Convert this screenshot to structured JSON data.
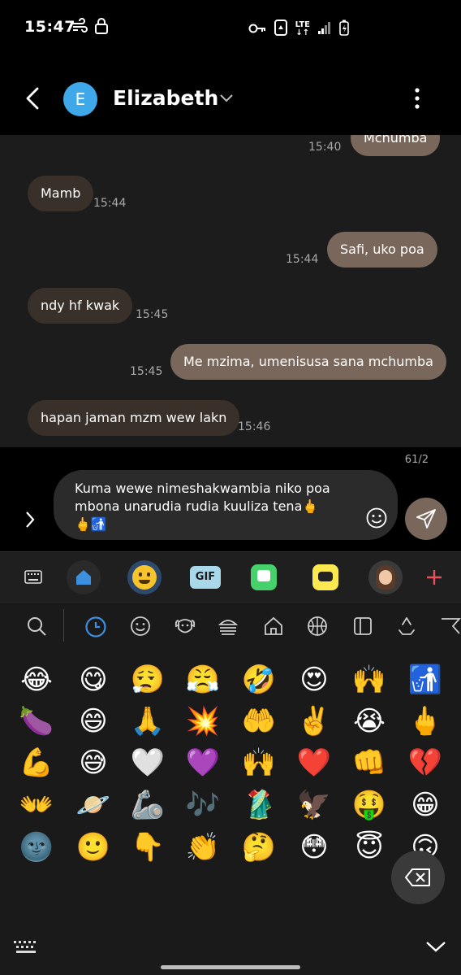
{
  "status_bar": {
    "time": "15:47",
    "network": "LTE"
  },
  "header": {
    "avatar_letter": "E",
    "contact_name": "Elizabeth",
    "avatar_color": "#3ea8e8"
  },
  "messages": [
    {
      "dir": "out",
      "text": "Mchumba",
      "time": "15:40"
    },
    {
      "dir": "in",
      "text": "Mamb",
      "time": "15:44"
    },
    {
      "dir": "out",
      "text": "Safi, uko poa",
      "time": "15:44"
    },
    {
      "dir": "in",
      "text": "ndy hf kwak",
      "time": "15:45"
    },
    {
      "dir": "out",
      "text": "Me mzima, umenisusa sana mchumba",
      "time": "15:45"
    },
    {
      "dir": "in",
      "text": "hapan jaman mzm wew lakn",
      "time": "15:46"
    }
  ],
  "composer": {
    "counter": "61/2",
    "line1": "Kuma wewe nimeshakwambia niko poa",
    "line2": "mbona unarudia rudia kuuliza tena🖕",
    "line3": "🖕🚮"
  },
  "keyboard_toolbar": {
    "items": [
      "keyboard-icon",
      "home-icon",
      "emoji-icon",
      "GIF",
      "sticker-icon",
      "bitmoji-icon",
      "avatar-sticker-icon",
      "plus-icon"
    ],
    "gif_label": "GIF"
  },
  "emoji_categories": [
    "search",
    "recent",
    "smileys",
    "animals",
    "food",
    "places",
    "sports",
    "objects",
    "symbols",
    "flags"
  ],
  "emoji_rows": [
    [
      "😂",
      "😋",
      "😮‍💨",
      "😤",
      "🤣",
      "😍",
      "🙌",
      "🚮"
    ],
    [
      "🍆",
      "😄",
      "🙏",
      "💥",
      "🤲",
      "✌️",
      "😭",
      "🖕"
    ],
    [
      "💪",
      "😅",
      "🤍",
      "💜",
      "🙌",
      "❤️",
      "👊",
      "💔"
    ],
    [
      "👐",
      "🪐",
      "🦾",
      "🎶",
      "🥻",
      "🦅",
      "🤑",
      "😁"
    ],
    [
      "🌚",
      "🙂",
      "👇",
      "👏",
      "🤔",
      "😳",
      "😇",
      "🙃"
    ]
  ],
  "colors": {
    "outgoing_bubble": "#7a675b",
    "incoming_bubble": "#3a302a",
    "accent_blue": "#3d8fe0",
    "plus_red": "#e8505b"
  }
}
